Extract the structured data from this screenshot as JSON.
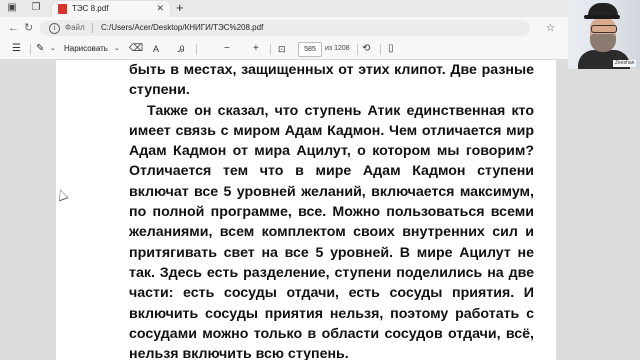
{
  "tab": {
    "title": "ТЭС 8.pdf",
    "close": "✕",
    "new_tab": "+"
  },
  "address": {
    "label": "Файл",
    "url": "C:/Users/Acer/Desktop/КНИГИ/ТЭС%208.pdf"
  },
  "toolbar": {
    "draw_label": "Нарисовать",
    "page_current": "585",
    "page_total": "из 1208"
  },
  "document": {
    "paragraphs": [
      "быть в местах, защищенных от этих клипот. Две разные ступени.",
      "Также он сказал, что ступень Атик единственная кто имеет связь с миром Адам Кадмон. Чем отличается мир Адам Кадмон от мира Ацилут, о котором мы говорим? Отличается тем что в мире Адам Кадмон ступени включат все 5 уровней желаний, включается максимум, по полной программе, все. Можно пользоваться всеми желаниями, всем комплектом своих внутренних сил и притягивать свет на все 5 уровней. В мире Ацилут не так. Здесь есть разделение, ступени поделились на две части: есть сосуды отдачи, есть сосуды приятия. И включить сосуды приятия нельзя, поэтому работать с сосудами можно только в области сосудов отдачи, всё, нельзя включить всю ступень."
    ]
  },
  "webcam": {
    "name_tag": "Zeeshan"
  },
  "colors": {
    "pdf_icon": "#d9342b",
    "page_bg": "#ffffff",
    "doc_bg": "#dcdcdc"
  },
  "icons": [
    "workspaces-icon",
    "tab-actions-icon",
    "pdf-file-icon",
    "back-icon",
    "refresh-icon",
    "info-icon",
    "favorite-icon",
    "table-of-contents-icon",
    "draw-chevron-icon",
    "erase-icon",
    "text-icon",
    "read-aloud-icon",
    "fit-page-icon",
    "rotate-icon",
    "page-view-icon"
  ]
}
